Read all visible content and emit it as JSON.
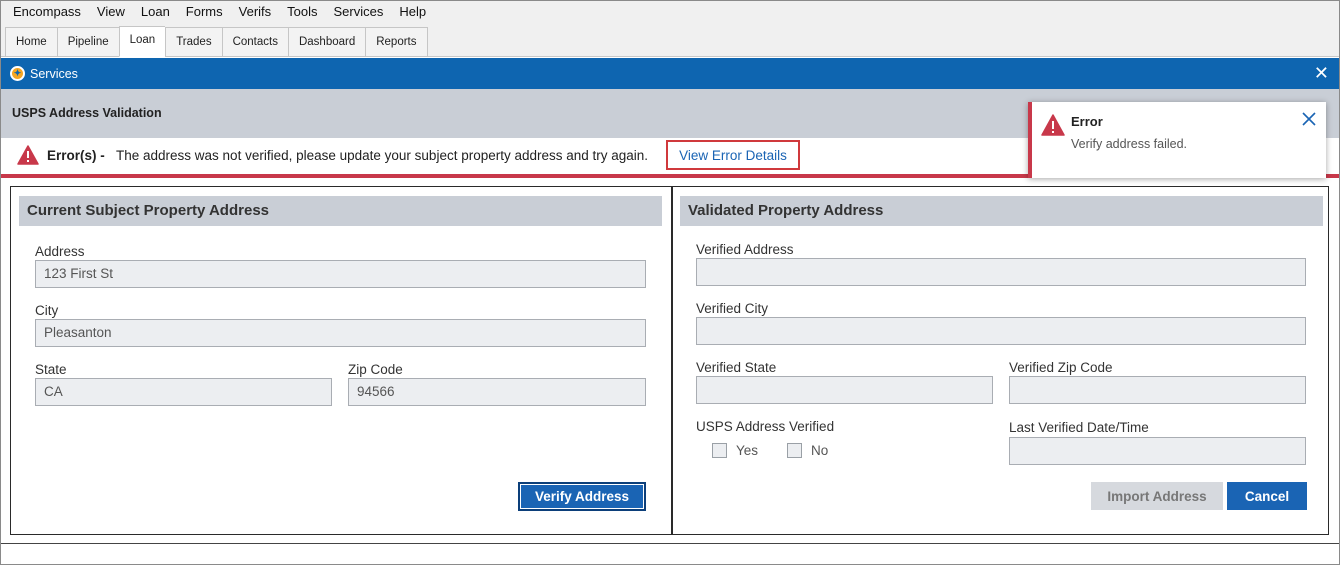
{
  "menu": [
    "Encompass",
    "View",
    "Loan",
    "Forms",
    "Verifs",
    "Tools",
    "Services",
    "Help"
  ],
  "tabs": [
    "Home",
    "Pipeline",
    "Loan",
    "Trades",
    "Contacts",
    "Dashboard",
    "Reports"
  ],
  "active_tab": "Loan",
  "services": {
    "title": "Services",
    "close": "✕"
  },
  "usps": {
    "title": "USPS Address Validation"
  },
  "error_strip": {
    "label": "Error(s) -",
    "message": "The address was not verified, please update your subject property address and try again.",
    "link": "View Error Details"
  },
  "current": {
    "heading": "Current Subject Property Address",
    "address_label": "Address",
    "address_value": "123 First St",
    "city_label": "City",
    "city_value": "Pleasanton",
    "state_label": "State",
    "state_value": "CA",
    "zip_label": "Zip Code",
    "zip_value": "94566",
    "verify_button": "Verify Address"
  },
  "validated": {
    "heading": "Validated Property Address",
    "address_label": "Verified Address",
    "address_value": "",
    "city_label": "Verified City",
    "city_value": "",
    "state_label": "Verified State",
    "state_value": "",
    "zip_label": "Verified Zip Code",
    "zip_value": "",
    "usps_verified_label": "USPS Address Verified",
    "yes_label": "Yes",
    "no_label": "No",
    "yes_checked": false,
    "no_checked": false,
    "last_verified_label": "Last Verified Date/Time",
    "last_verified_value": "",
    "import_button": "Import Address",
    "cancel_button": "Cancel"
  },
  "toast": {
    "title": "Error",
    "message": "Verify address failed."
  },
  "colors": {
    "brand_blue": "#0e65b0",
    "button_blue": "#1a64b4",
    "error_red": "#c8384a",
    "header_gray": "#c9ced6"
  }
}
